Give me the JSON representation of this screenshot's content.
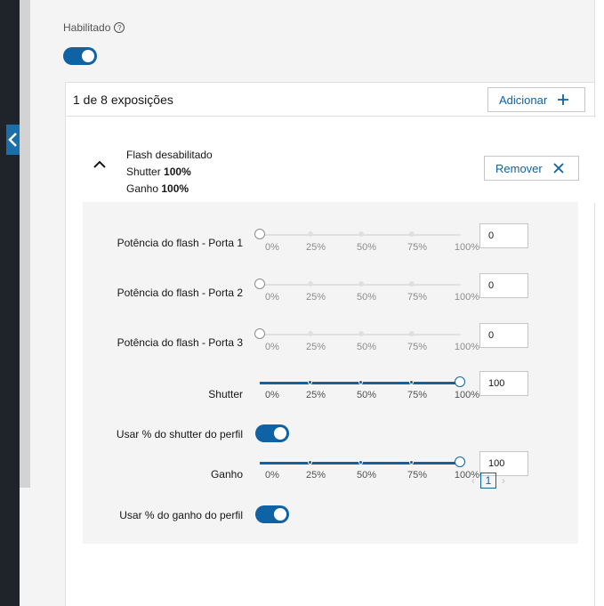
{
  "enabled": {
    "label": "Habilitado",
    "help_icon": "help-icon",
    "on": true
  },
  "exposures": {
    "count_text": "1 de 8 exposições",
    "add_label": "Adicionar",
    "add_icon": "plus-icon"
  },
  "exposure": {
    "flash_text": "Flash desabilitado",
    "shutter_prefix": "Shutter",
    "shutter_value": "100%",
    "gain_prefix": "Ganho",
    "gain_value": "100%",
    "remove_label": "Remover",
    "remove_icon": "close-icon"
  },
  "ticks": [
    "0%",
    "25%",
    "50%",
    "75%",
    "100%"
  ],
  "rows": [
    {
      "label": "Potência do flash - Porta 1",
      "value": "0",
      "level": 0
    },
    {
      "label": "Potência do flash - Porta 2",
      "value": "0",
      "level": 0
    },
    {
      "label": "Potência do flash - Porta 3",
      "value": "0",
      "level": 0
    },
    {
      "label": "Shutter",
      "value": "100",
      "level": 1
    },
    {
      "label": "Ganho",
      "value": "100",
      "level": 1
    }
  ],
  "toggles": [
    {
      "label": "Usar % do shutter do perfil",
      "on": true
    },
    {
      "label": "Usar % do ganho do perfil",
      "on": true
    }
  ],
  "pagination": {
    "prev": "‹",
    "page": "1",
    "next": "›"
  },
  "colors": {
    "accent": "#0f62a4",
    "rail": "#1f232a"
  }
}
